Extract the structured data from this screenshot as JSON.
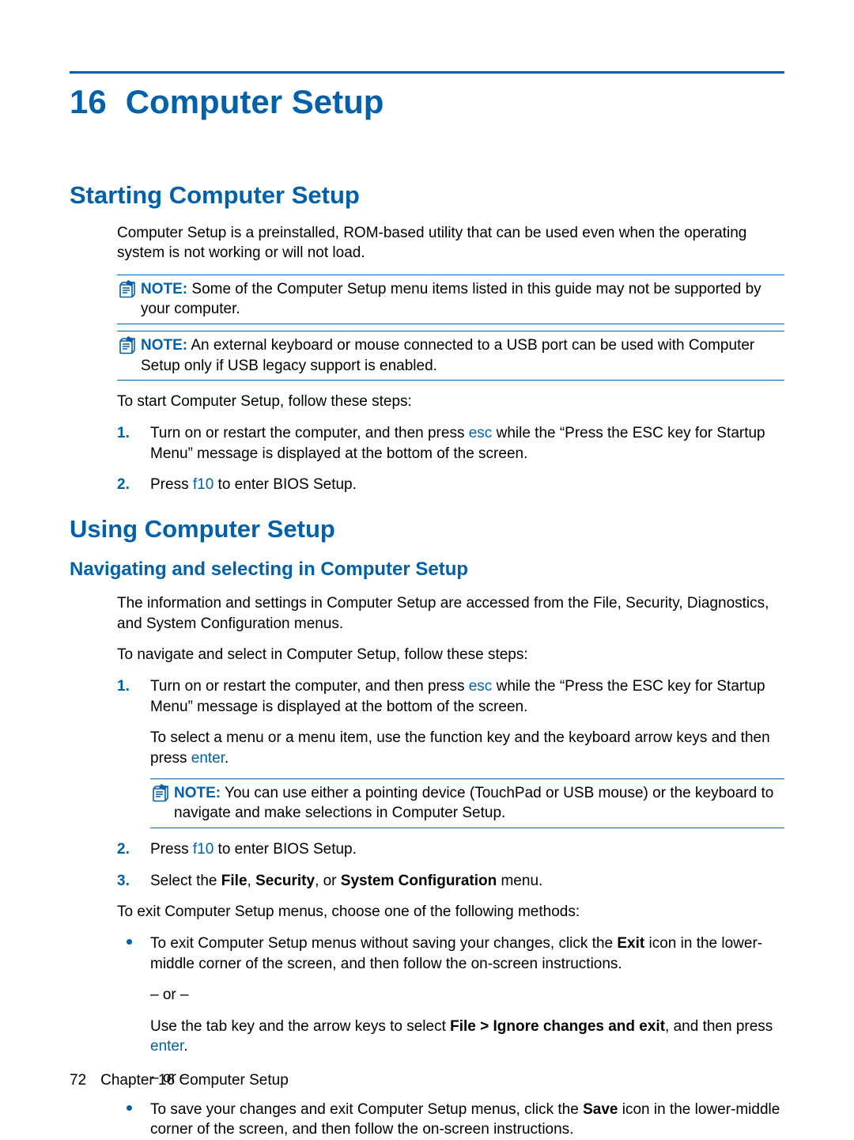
{
  "chapter": {
    "number": "16",
    "title": "Computer Setup"
  },
  "section1": {
    "heading": "Starting Computer Setup",
    "intro": "Computer Setup is a preinstalled, ROM-based utility that can be used even when the operating system is not working or will not load.",
    "note1_label": "NOTE:",
    "note1_text": "Some of the Computer Setup menu items listed in this guide may not be supported by your computer.",
    "note2_label": "NOTE:",
    "note2_text": "An external keyboard or mouse connected to a USB port can be used with Computer Setup only if USB legacy support is enabled.",
    "lead": "To start Computer Setup, follow these steps:",
    "step1_num": "1.",
    "step1_a": "Turn on or restart the computer, and then press ",
    "step1_key": "esc",
    "step1_b": " while the “Press the ESC key for Startup Menu” message is displayed at the bottom of the screen.",
    "step2_num": "2.",
    "step2_a": "Press ",
    "step2_key": "f10",
    "step2_b": " to enter BIOS Setup."
  },
  "section2": {
    "heading": "Using Computer Setup",
    "sub_heading": "Navigating and selecting in Computer Setup",
    "p1": "The information and settings in Computer Setup are accessed from the File, Security, Diagnostics, and System Configuration menus.",
    "p2": "To navigate and select in Computer Setup, follow these steps:",
    "s1_num": "1.",
    "s1_a": "Turn on or restart the computer, and then press ",
    "s1_key": "esc",
    "s1_b": " while the “Press the ESC key for Startup Menu” message is displayed at the bottom of the screen.",
    "s1_p2a": "To select a menu or a menu item, use the function key and the keyboard arrow keys and then press ",
    "s1_p2key": "enter",
    "s1_p2b": ".",
    "note3_label": "NOTE:",
    "note3_text": "You can use either a pointing device (TouchPad or USB mouse) or the keyboard to navigate and make selections in Computer Setup.",
    "s2_num": "2.",
    "s2_a": "Press ",
    "s2_key": "f10",
    "s2_b": " to enter BIOS Setup.",
    "s3_num": "3.",
    "s3_a": "Select the ",
    "s3_file": "File",
    "s3_comma": ", ",
    "s3_sec": "Security",
    "s3_or": ", or ",
    "s3_sys": "System Configuration",
    "s3_b": " menu.",
    "exitlead": "To exit Computer Setup menus, choose one of the following methods:",
    "b1_a": "To exit Computer Setup menus without saving your changes, click the ",
    "b1_exit": "Exit",
    "b1_b": " icon in the lower-middle corner of the screen, and then follow the on-screen instructions.",
    "or": "– or –",
    "b1_p2a": "Use the tab key and the arrow keys to select ",
    "b1_p2bold": "File > Ignore changes and exit",
    "b1_p2b": ", and then press ",
    "b1_p2key": "enter",
    "b1_p2c": ".",
    "b2_a": "To save your changes and exit Computer Setup menus, click the ",
    "b2_save": "Save",
    "b2_b": " icon in the lower-middle corner of the screen, and then follow the on-screen instructions."
  },
  "footer": {
    "page": "72",
    "text": "Chapter 16   Computer Setup"
  }
}
